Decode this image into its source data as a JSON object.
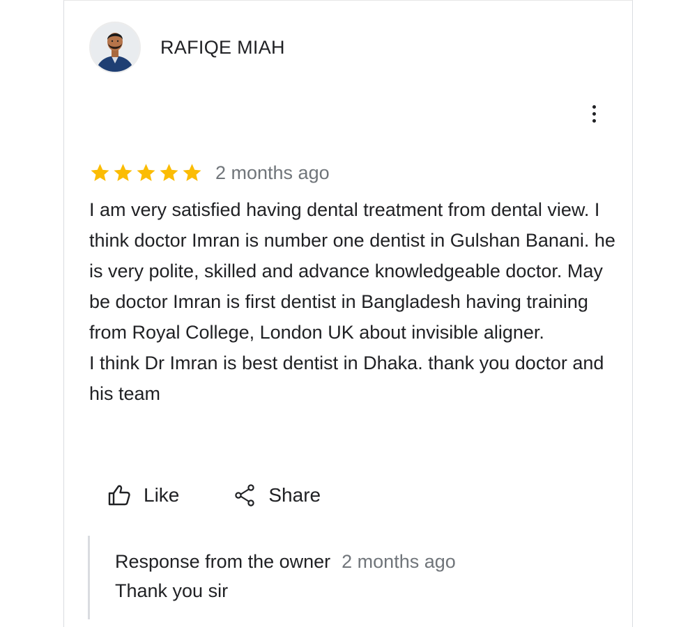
{
  "review": {
    "reviewer_name": "RAFIQE MIAH",
    "rating": 5,
    "rating_max": 5,
    "time": "2 months ago",
    "text_paragraphs": [
      "I am very satisfied having dental treatment from dental view. I think doctor Imran is number one dentist in Gulshan Banani. he is very polite, skilled and advance knowledgeable doctor. May be doctor Imran is first dentist in Bangladesh having training from Royal College, London UK about invisible aligner.",
      "I think Dr Imran is best dentist in Dhaka. thank you doctor and his team"
    ]
  },
  "actions": {
    "like_label": "Like",
    "like_icon": "thumbs-up-icon",
    "share_label": "Share",
    "share_icon": "share-icon",
    "more_icon": "more-vert-icon"
  },
  "owner_response": {
    "title": "Response from the owner",
    "time": "2 months ago",
    "text": "Thank you sir"
  },
  "colors": {
    "star": "#fbbc04",
    "text": "#202124",
    "secondary_text": "#70757a",
    "divider": "#dadce0"
  }
}
